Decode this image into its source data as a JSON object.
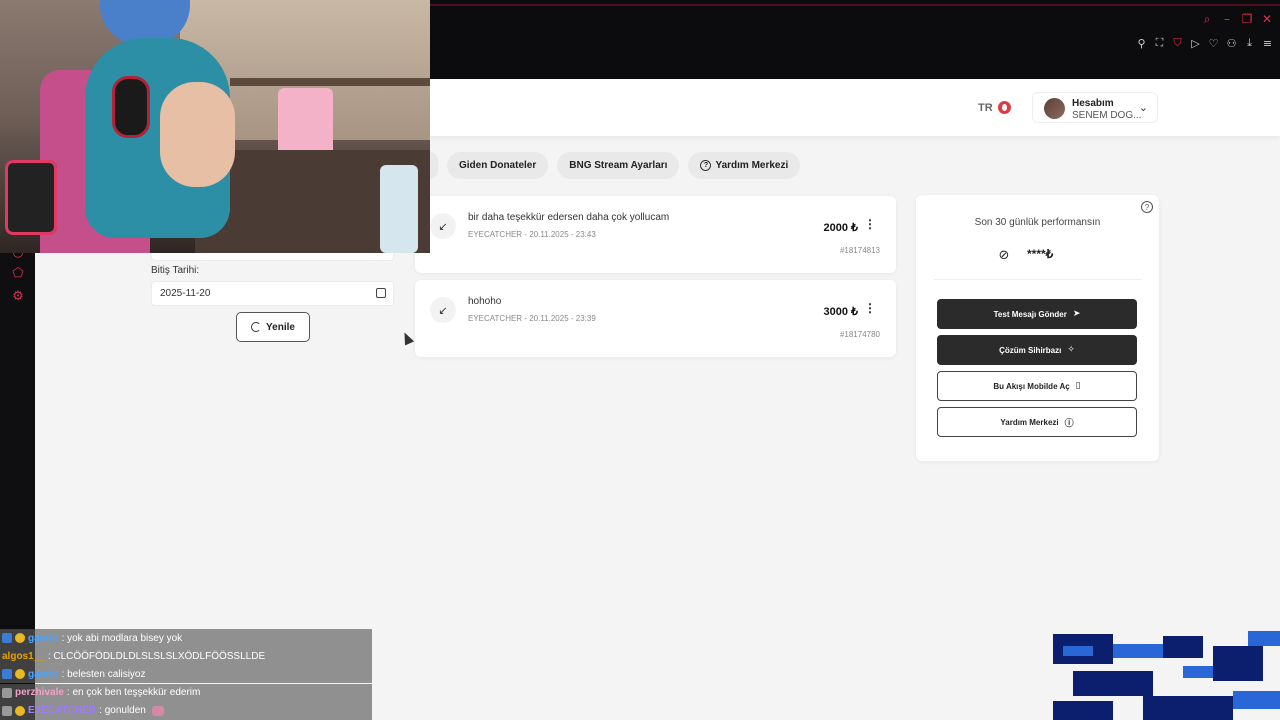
{
  "header": {
    "lang_code": "TR",
    "account_title": "Hesabım",
    "account_name": "SENEM DOG..."
  },
  "tabs": [
    {
      "label": "Giden Donateler"
    },
    {
      "label": "BNG Stream Ayarları"
    },
    {
      "label": "Yardım Merkezi"
    }
  ],
  "filters": {
    "end_date_label": "Bitiş Tarihi:",
    "end_date_value": "2025-11-20",
    "refresh_label": "Yenile"
  },
  "donations": [
    {
      "message": "bir daha teşekkür edersen daha çok yollucam",
      "meta": "EYECATCHER - 20.11.2025 - 23:43",
      "amount": "2000 ₺",
      "id": "#18174813"
    },
    {
      "message": "hohoho",
      "meta": "EYECATCHER - 20.11.2025 - 23:39",
      "amount": "3000 ₺",
      "id": "#18174780"
    }
  ],
  "performance": {
    "title": "Son 30 günlük performansın",
    "hidden_value": "****₺",
    "buttons": [
      {
        "label": "Test Mesajı Gönder",
        "icon": "send-icon"
      },
      {
        "label": "Çözüm Sihirbazı",
        "icon": "wand-icon"
      },
      {
        "label": "Bu Akışı Mobilde Aç",
        "icon": "phone-icon"
      },
      {
        "label": "Yardım Merkezi",
        "icon": "help-icon"
      }
    ]
  },
  "chat": [
    {
      "user": "gamtır",
      "text": ": yok abi modlara bisey yok"
    },
    {
      "user": "algos1__",
      "text": ": CLCÖÖFÖDLDLDLSLSLSLXÖDLFÖÖSSLLDE"
    },
    {
      "user": "gamtır",
      "text": ": belesten calisiyoz"
    },
    {
      "user": "perzhivale",
      "text": ": en çok ben teşşekkür ederim"
    },
    {
      "user": "EYECATCHER",
      "text": ": gonulden"
    }
  ],
  "colors": {
    "accent": "#2b2b2b",
    "brand_red": "#e0304a",
    "background": "#f4f4f4"
  }
}
